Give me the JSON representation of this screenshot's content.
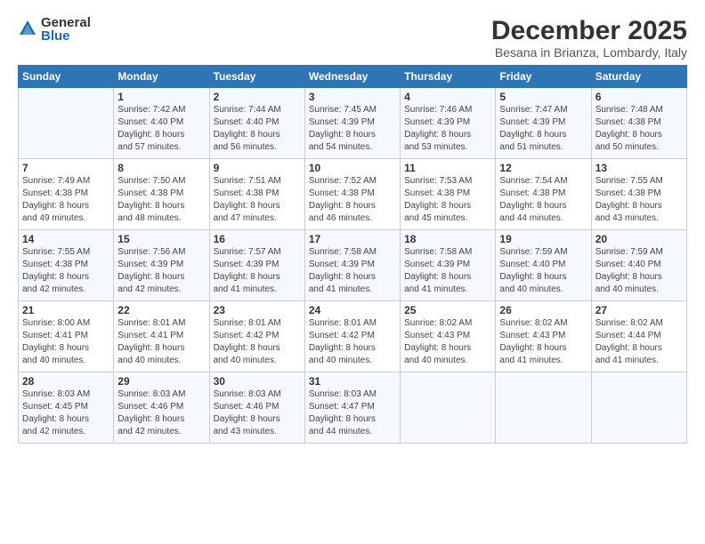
{
  "logo": {
    "general": "General",
    "blue": "Blue"
  },
  "header": {
    "month": "December 2025",
    "location": "Besana in Brianza, Lombardy, Italy"
  },
  "days_of_week": [
    "Sunday",
    "Monday",
    "Tuesday",
    "Wednesday",
    "Thursday",
    "Friday",
    "Saturday"
  ],
  "weeks": [
    [
      {
        "day": "",
        "info": ""
      },
      {
        "day": "1",
        "info": "Sunrise: 7:42 AM\nSunset: 4:40 PM\nDaylight: 8 hours\nand 57 minutes."
      },
      {
        "day": "2",
        "info": "Sunrise: 7:44 AM\nSunset: 4:40 PM\nDaylight: 8 hours\nand 56 minutes."
      },
      {
        "day": "3",
        "info": "Sunrise: 7:45 AM\nSunset: 4:39 PM\nDaylight: 8 hours\nand 54 minutes."
      },
      {
        "day": "4",
        "info": "Sunrise: 7:46 AM\nSunset: 4:39 PM\nDaylight: 8 hours\nand 53 minutes."
      },
      {
        "day": "5",
        "info": "Sunrise: 7:47 AM\nSunset: 4:39 PM\nDaylight: 8 hours\nand 51 minutes."
      },
      {
        "day": "6",
        "info": "Sunrise: 7:48 AM\nSunset: 4:38 PM\nDaylight: 8 hours\nand 50 minutes."
      }
    ],
    [
      {
        "day": "7",
        "info": "Sunrise: 7:49 AM\nSunset: 4:38 PM\nDaylight: 8 hours\nand 49 minutes."
      },
      {
        "day": "8",
        "info": "Sunrise: 7:50 AM\nSunset: 4:38 PM\nDaylight: 8 hours\nand 48 minutes."
      },
      {
        "day": "9",
        "info": "Sunrise: 7:51 AM\nSunset: 4:38 PM\nDaylight: 8 hours\nand 47 minutes."
      },
      {
        "day": "10",
        "info": "Sunrise: 7:52 AM\nSunset: 4:38 PM\nDaylight: 8 hours\nand 46 minutes."
      },
      {
        "day": "11",
        "info": "Sunrise: 7:53 AM\nSunset: 4:38 PM\nDaylight: 8 hours\nand 45 minutes."
      },
      {
        "day": "12",
        "info": "Sunrise: 7:54 AM\nSunset: 4:38 PM\nDaylight: 8 hours\nand 44 minutes."
      },
      {
        "day": "13",
        "info": "Sunrise: 7:55 AM\nSunset: 4:38 PM\nDaylight: 8 hours\nand 43 minutes."
      }
    ],
    [
      {
        "day": "14",
        "info": "Sunrise: 7:55 AM\nSunset: 4:38 PM\nDaylight: 8 hours\nand 42 minutes."
      },
      {
        "day": "15",
        "info": "Sunrise: 7:56 AM\nSunset: 4:39 PM\nDaylight: 8 hours\nand 42 minutes."
      },
      {
        "day": "16",
        "info": "Sunrise: 7:57 AM\nSunset: 4:39 PM\nDaylight: 8 hours\nand 41 minutes."
      },
      {
        "day": "17",
        "info": "Sunrise: 7:58 AM\nSunset: 4:39 PM\nDaylight: 8 hours\nand 41 minutes."
      },
      {
        "day": "18",
        "info": "Sunrise: 7:58 AM\nSunset: 4:39 PM\nDaylight: 8 hours\nand 41 minutes."
      },
      {
        "day": "19",
        "info": "Sunrise: 7:59 AM\nSunset: 4:40 PM\nDaylight: 8 hours\nand 40 minutes."
      },
      {
        "day": "20",
        "info": "Sunrise: 7:59 AM\nSunset: 4:40 PM\nDaylight: 8 hours\nand 40 minutes."
      }
    ],
    [
      {
        "day": "21",
        "info": "Sunrise: 8:00 AM\nSunset: 4:41 PM\nDaylight: 8 hours\nand 40 minutes."
      },
      {
        "day": "22",
        "info": "Sunrise: 8:01 AM\nSunset: 4:41 PM\nDaylight: 8 hours\nand 40 minutes."
      },
      {
        "day": "23",
        "info": "Sunrise: 8:01 AM\nSunset: 4:42 PM\nDaylight: 8 hours\nand 40 minutes."
      },
      {
        "day": "24",
        "info": "Sunrise: 8:01 AM\nSunset: 4:42 PM\nDaylight: 8 hours\nand 40 minutes."
      },
      {
        "day": "25",
        "info": "Sunrise: 8:02 AM\nSunset: 4:43 PM\nDaylight: 8 hours\nand 40 minutes."
      },
      {
        "day": "26",
        "info": "Sunrise: 8:02 AM\nSunset: 4:43 PM\nDaylight: 8 hours\nand 41 minutes."
      },
      {
        "day": "27",
        "info": "Sunrise: 8:02 AM\nSunset: 4:44 PM\nDaylight: 8 hours\nand 41 minutes."
      }
    ],
    [
      {
        "day": "28",
        "info": "Sunrise: 8:03 AM\nSunset: 4:45 PM\nDaylight: 8 hours\nand 42 minutes."
      },
      {
        "day": "29",
        "info": "Sunrise: 8:03 AM\nSunset: 4:46 PM\nDaylight: 8 hours\nand 42 minutes."
      },
      {
        "day": "30",
        "info": "Sunrise: 8:03 AM\nSunset: 4:46 PM\nDaylight: 8 hours\nand 43 minutes."
      },
      {
        "day": "31",
        "info": "Sunrise: 8:03 AM\nSunset: 4:47 PM\nDaylight: 8 hours\nand 44 minutes."
      },
      {
        "day": "",
        "info": ""
      },
      {
        "day": "",
        "info": ""
      },
      {
        "day": "",
        "info": ""
      }
    ]
  ]
}
